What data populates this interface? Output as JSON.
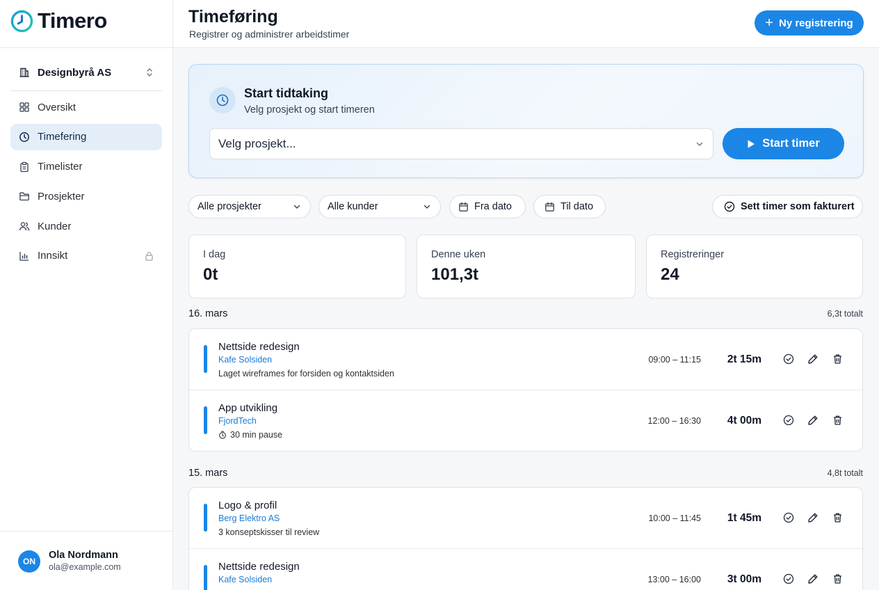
{
  "app": {
    "name": "Timero"
  },
  "org": {
    "name": "Designbyrå AS"
  },
  "nav": [
    {
      "label": "Oversikt",
      "icon": "grid-icon"
    },
    {
      "label": "Timefering",
      "icon": "clock-icon",
      "active": true
    },
    {
      "label": "Timelister",
      "icon": "clipboard-icon"
    },
    {
      "label": "Prosjekter",
      "icon": "folder-icon"
    },
    {
      "label": "Kunder",
      "icon": "users-icon"
    },
    {
      "label": "Innsikt",
      "icon": "bar-chart-icon",
      "locked": true
    }
  ],
  "user": {
    "initials": "ON",
    "name": "Ola Nordmann",
    "email": "ola@example.com"
  },
  "header": {
    "title": "Timeføring",
    "subtitle": "Registrer og administrer arbeidstimer",
    "new_button": "Ny registrering"
  },
  "timer": {
    "title": "Start tidtaking",
    "subtitle": "Velg prosjekt og start timeren",
    "project_placeholder": "Velg prosjekt...",
    "start_button": "Start timer"
  },
  "filters": {
    "projects": "Alle prosjekter",
    "customers": "Alle kunder",
    "from_date": "Fra dato",
    "to_date": "Til dato",
    "mark_billed": "Sett timer som fakturert"
  },
  "stats": [
    {
      "label": "I dag",
      "value": "0t"
    },
    {
      "label": "Denne uken",
      "value": "101,3t"
    },
    {
      "label": "Registreringer",
      "value": "24"
    }
  ],
  "days": [
    {
      "date": "16. mars",
      "total": "6,3t totalt",
      "entries": [
        {
          "project": "Nettside redesign",
          "customer": "Kafe Solsiden",
          "note": "Laget wireframes for forsiden og kontaktsiden",
          "time": "09:00 – 11:15",
          "duration": "2t 15m"
        },
        {
          "project": "App utvikling",
          "customer": "FjordTech",
          "note": "30 min pause",
          "note_icon": "timer-icon",
          "time": "12:00 – 16:30",
          "duration": "4t 00m"
        }
      ]
    },
    {
      "date": "15. mars",
      "total": "4,8t totalt",
      "entries": [
        {
          "project": "Logo & profil",
          "customer": "Berg Elektro AS",
          "note": "3 konseptskisser til review",
          "time": "10:00 – 11:45",
          "duration": "1t 45m"
        },
        {
          "project": "Nettside redesign",
          "customer": "Kafe Solsiden",
          "note": "",
          "time": "13:00 – 16:00",
          "duration": "3t 00m"
        }
      ]
    }
  ],
  "colors": {
    "accent": "#1b86e6",
    "customer_link": "#1b7bd6",
    "active_nav_bg": "#e4eef9"
  }
}
